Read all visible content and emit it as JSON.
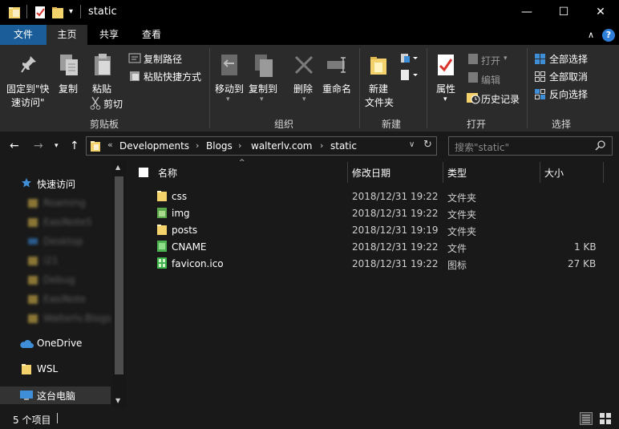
{
  "window": {
    "title": "static",
    "minimize": "—",
    "maximize": "☐",
    "close": "✕"
  },
  "ribbon_tabs": {
    "file": "文件",
    "home": "主页",
    "share": "共享",
    "view": "查看",
    "help": "?"
  },
  "ribbon": {
    "clipboard": {
      "group_label": "剪贴板",
      "pin_line1": "固定到\"快",
      "pin_line2": "速访问\"",
      "copy": "复制",
      "paste": "粘贴",
      "copy_path": "复制路径",
      "paste_shortcut": "粘贴快捷方式",
      "cut": "剪切"
    },
    "organize": {
      "group_label": "组织",
      "move_to": "移动到",
      "copy_to": "复制到",
      "delete": "删除",
      "rename": "重命名"
    },
    "new": {
      "group_label": "新建",
      "new_folder_line1": "新建",
      "new_folder_line2": "文件夹"
    },
    "open": {
      "group_label": "打开",
      "properties": "属性",
      "open": "打开",
      "edit": "编辑",
      "history": "历史记录"
    },
    "select": {
      "group_label": "选择",
      "select_all": "全部选择",
      "select_none": "全部取消",
      "invert": "反向选择"
    }
  },
  "address": {
    "overflow": "«",
    "crumbs": [
      "Developments",
      "Blogs",
      "walterlv.com",
      "static"
    ],
    "separator": "›",
    "search_placeholder": "搜索\"static\""
  },
  "nav_pane": {
    "quick_access": "快速访问",
    "blurred_items": [
      "Roaming",
      "EasiNote5",
      "Desktop",
      "i21",
      "Debug",
      "EasiNote",
      "Walterlv.Blogs"
    ],
    "onedrive": "OneDrive",
    "wsl": "WSL",
    "this_pc": "这台电脑"
  },
  "columns": {
    "name": "名称",
    "modified": "修改日期",
    "type": "类型",
    "size": "大小"
  },
  "files": [
    {
      "name": "css",
      "modified": "2018/12/31 19:22",
      "type": "文件夹",
      "size": "",
      "icon": "folder-icon"
    },
    {
      "name": "img",
      "modified": "2018/12/31 19:22",
      "type": "文件夹",
      "size": "",
      "icon": "folder-icon"
    },
    {
      "name": "posts",
      "modified": "2018/12/31 19:19",
      "type": "文件夹",
      "size": "",
      "icon": "folder-icon"
    },
    {
      "name": "CNAME",
      "modified": "2018/12/31 19:22",
      "type": "文件",
      "size": "1 KB",
      "icon": "file-icon"
    },
    {
      "name": "favicon.ico",
      "modified": "2018/12/31 19:22",
      "type": "图标",
      "size": "27 KB",
      "icon": "ico-file-icon"
    }
  ],
  "status": {
    "item_count": "5 个项目"
  },
  "colors": {
    "accent": "#1a5d98",
    "folder": "#f3d26b",
    "ico_green": "#3fb54d",
    "background": "#191919"
  }
}
